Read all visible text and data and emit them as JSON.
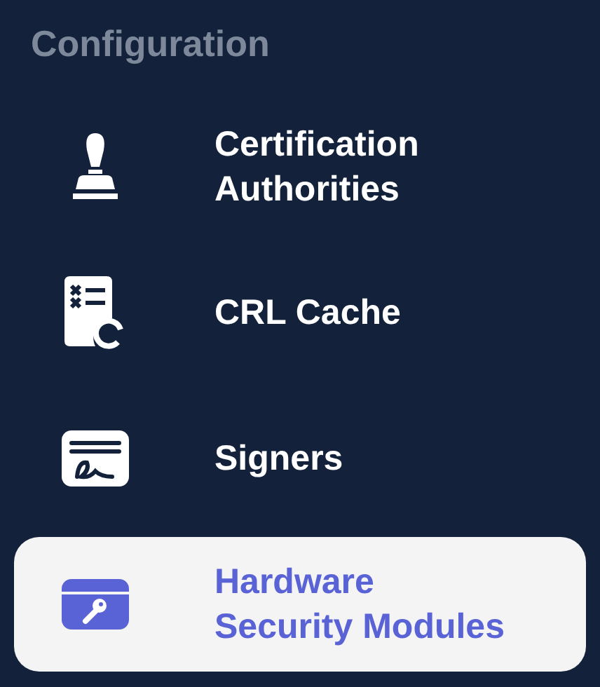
{
  "section_title": "Configuration",
  "items": [
    {
      "label": "Certification Authorities",
      "selected": false
    },
    {
      "label": "CRL Cache",
      "selected": false
    },
    {
      "label": "Signers",
      "selected": false
    },
    {
      "label": "Hardware Security Modules",
      "selected": true
    }
  ]
}
